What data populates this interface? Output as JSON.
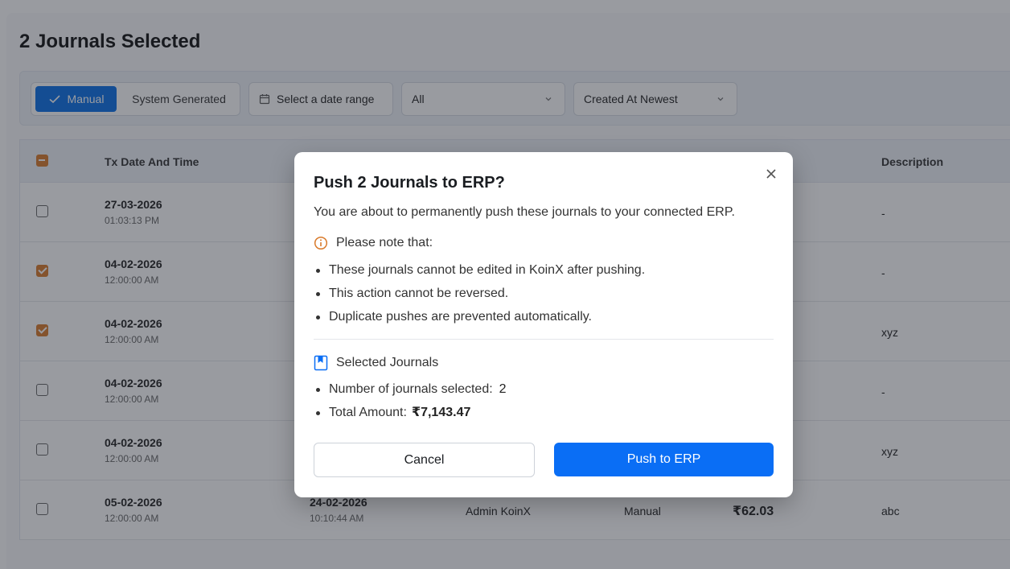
{
  "page": {
    "title": "2 Journals Selected"
  },
  "filters": {
    "segment": {
      "manual": "Manual",
      "system": "System Generated"
    },
    "date_range": "Select a date range",
    "status": "All",
    "sort": "Created At Newest"
  },
  "table": {
    "columns": {
      "tx_date": "Tx Date And Time",
      "description": "Description"
    },
    "rows": [
      {
        "date": "27-03-2026",
        "time": "01:03:13 PM",
        "description": "-",
        "checked": false
      },
      {
        "date": "04-02-2026",
        "time": "12:00:00 AM",
        "description": "-",
        "checked": true
      },
      {
        "date": "04-02-2026",
        "time": "12:00:00 AM",
        "description": "xyz",
        "checked": true
      },
      {
        "date": "04-02-2026",
        "time": "12:00:00 AM",
        "description": "-",
        "checked": false
      },
      {
        "date": "04-02-2026",
        "time": "12:00:00 AM",
        "description": "xyz",
        "checked": false
      },
      {
        "date": "05-02-2026",
        "time": "12:00:00 AM",
        "date2": "24-02-2026",
        "time2": "10:10:44 AM",
        "creator": "Admin KoinX",
        "type": "Manual",
        "amount": "₹62.03",
        "description": "abc",
        "checked": false
      }
    ]
  },
  "modal": {
    "title": "Push 2 Journals to ERP?",
    "subtitle": "You are about to permanently push these journals to your connected ERP.",
    "note_label": "Please note that:",
    "notes": [
      "These journals cannot be edited in KoinX after pushing.",
      "This action cannot be reversed.",
      "Duplicate pushes are prevented automatically."
    ],
    "selected_label": "Selected Journals",
    "count_label": "Number of journals selected:",
    "count_value": "2",
    "total_label": "Total Amount:",
    "total_value": "₹7,143.47",
    "cancel_label": "Cancel",
    "push_label": "Push to ERP"
  },
  "colors": {
    "primary": "#0a6ef5",
    "checkbox": "#d97a2b",
    "info_icon": "#d97a2b"
  }
}
